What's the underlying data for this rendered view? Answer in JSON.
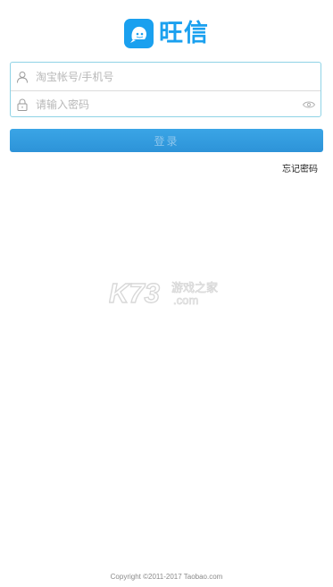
{
  "app": {
    "brand_name": "旺信"
  },
  "login_form": {
    "account_placeholder": "淘宝帐号/手机号",
    "password_placeholder": "请输入密码",
    "account_icon": "user-icon",
    "password_icon": "lock-icon",
    "visibility_icon": "eye-icon"
  },
  "actions": {
    "login_label": "登录",
    "forgot_password_label": "忘记密码"
  },
  "watermark": {
    "text_main": "K73",
    "text_cn": "游戏之家",
    "text_domain": ".com"
  },
  "footer": {
    "copyright": "Copyright ©2011-2017 Taobao.com"
  },
  "colors": {
    "brand_blue": "#1aa0ef",
    "button_blue": "#2d93d8",
    "input_border": "#8fd3e6"
  }
}
